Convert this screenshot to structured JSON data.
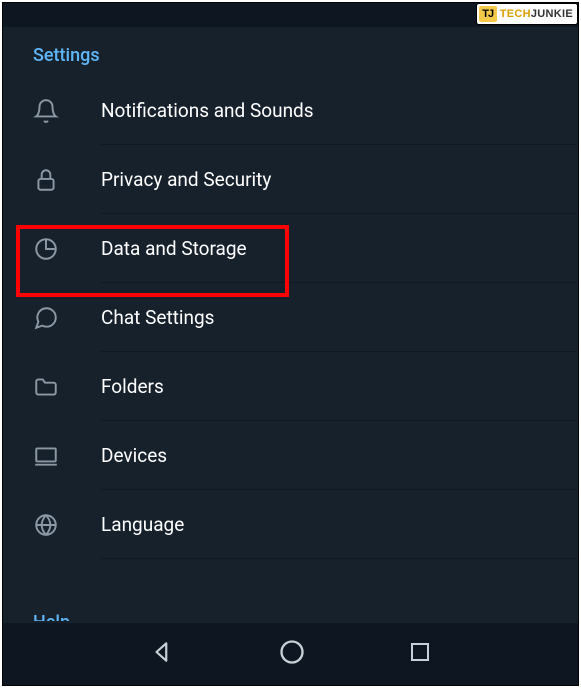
{
  "watermark": {
    "badge": "TJ",
    "text_part1": "TECH",
    "text_part2": "JUNKIE"
  },
  "section_title": "Settings",
  "items": [
    {
      "icon": "bell-icon",
      "label": "Notifications and Sounds"
    },
    {
      "icon": "lock-icon",
      "label": "Privacy and Security"
    },
    {
      "icon": "pie-icon",
      "label": "Data and Storage"
    },
    {
      "icon": "chat-icon",
      "label": "Chat Settings"
    },
    {
      "icon": "folder-icon",
      "label": "Folders"
    },
    {
      "icon": "devices-icon",
      "label": "Devices"
    },
    {
      "icon": "globe-icon",
      "label": "Language"
    }
  ],
  "highlighted_index": 2,
  "next_section_hint": "Help"
}
